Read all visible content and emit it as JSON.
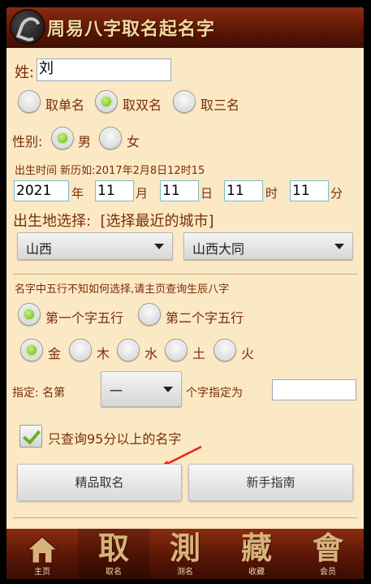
{
  "app": {
    "title": "周易八字取名起名字"
  },
  "form": {
    "surname_label": "姓:",
    "surname_value": "刘",
    "name_length_options": [
      "取单名",
      "取双名",
      "取三名"
    ],
    "name_length_selected": "取双名",
    "gender_label": "性别:",
    "gender_options": [
      "男",
      "女"
    ],
    "gender_selected": "男",
    "birth_time_label": "出生时间 新历如:2017年2月8日12时15",
    "birth": {
      "year": "2021",
      "year_unit": "年",
      "month": "11",
      "month_unit": "月",
      "day": "11",
      "day_unit": "日",
      "hour": "11",
      "hour_unit": "时",
      "minute": "11",
      "minute_unit": "分"
    },
    "birthplace_label": "出生地选择:  [选择最近的城市]",
    "province_selected": "山西",
    "city_selected": "山西大同",
    "wuxing_hint": "名字中五行不知如何选择,请主页查询生辰八字",
    "char_position_options": [
      "第一个字五行",
      "第二个字五行"
    ],
    "char_position_selected": "第一个字五行",
    "element_options": [
      "金",
      "木",
      "水",
      "土",
      "火"
    ],
    "element_selected": "金",
    "specify_label": "指定: 名第",
    "specify_position_selected": "一",
    "specify_suffix": "个字指定为",
    "specify_value": "",
    "score_filter_label": "只查询95分以上的名字",
    "score_filter_checked": true,
    "primary_button": "精品取名",
    "guide_button": "新手指南"
  },
  "tabs": [
    {
      "glyph": "",
      "label": "主页",
      "icon": "home-icon"
    },
    {
      "glyph": "取",
      "label": "取名",
      "active": true
    },
    {
      "glyph": "測",
      "label": "测名"
    },
    {
      "glyph": "藏",
      "label": "收藏"
    },
    {
      "glyph": "會",
      "label": "会员"
    }
  ],
  "colors": {
    "accent_text": "#7a2e0c",
    "background": "#fbe8c4",
    "bar": "#5a1606",
    "radio_on": "#7ed321",
    "arrow": "#e8241c"
  }
}
